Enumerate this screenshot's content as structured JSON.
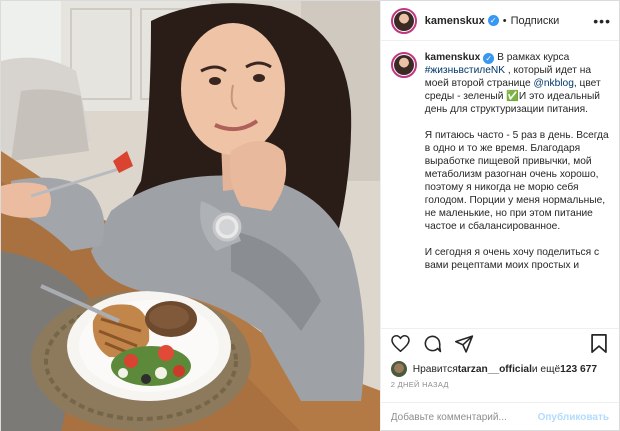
{
  "header": {
    "username": "kamenskux",
    "separator": "•",
    "follow_label": "Подписки",
    "more_label": "•••"
  },
  "caption": {
    "username": "kamenskux",
    "p1_a": "В рамках курса ",
    "hashtag": "#жизньвстилеNK",
    "p1_b": " , который идет на моей второй странице ",
    "mention": "@nkblog",
    "p1_c": ", цвет среды - зеленый ✅И это идеальный день для структуризации питания.",
    "p2": "Я питаюсь часто - 5 раз в день. Всегда в одно и то же время. Благодаря выработке пищевой привычки, мой метаболизм разогнан очень хорошо, поэтому я никогда не морю себя голодом. Порции у меня нормальные, не маленькие, но при этом питание частое и сбалансированное.",
    "p3": "И сегодня я очень хочу поделиться с вами рецептами моих простых и"
  },
  "actions": {
    "icons": [
      "heart-icon",
      "comment-icon",
      "share-icon",
      "bookmark-icon"
    ]
  },
  "likes": {
    "prefix": "Нравится ",
    "user": "tarzan__official",
    "middle": " и ещё ",
    "count": "123 677"
  },
  "time": "2 ДНЕЙ НАЗАД",
  "comment": {
    "placeholder": "Добавьте комментарий...",
    "publish_label": "Опубликовать"
  },
  "colors": {
    "accent": "#3897f0",
    "link": "#00376b",
    "publish": "#b3dbff",
    "muted": "#8e8e8e"
  }
}
